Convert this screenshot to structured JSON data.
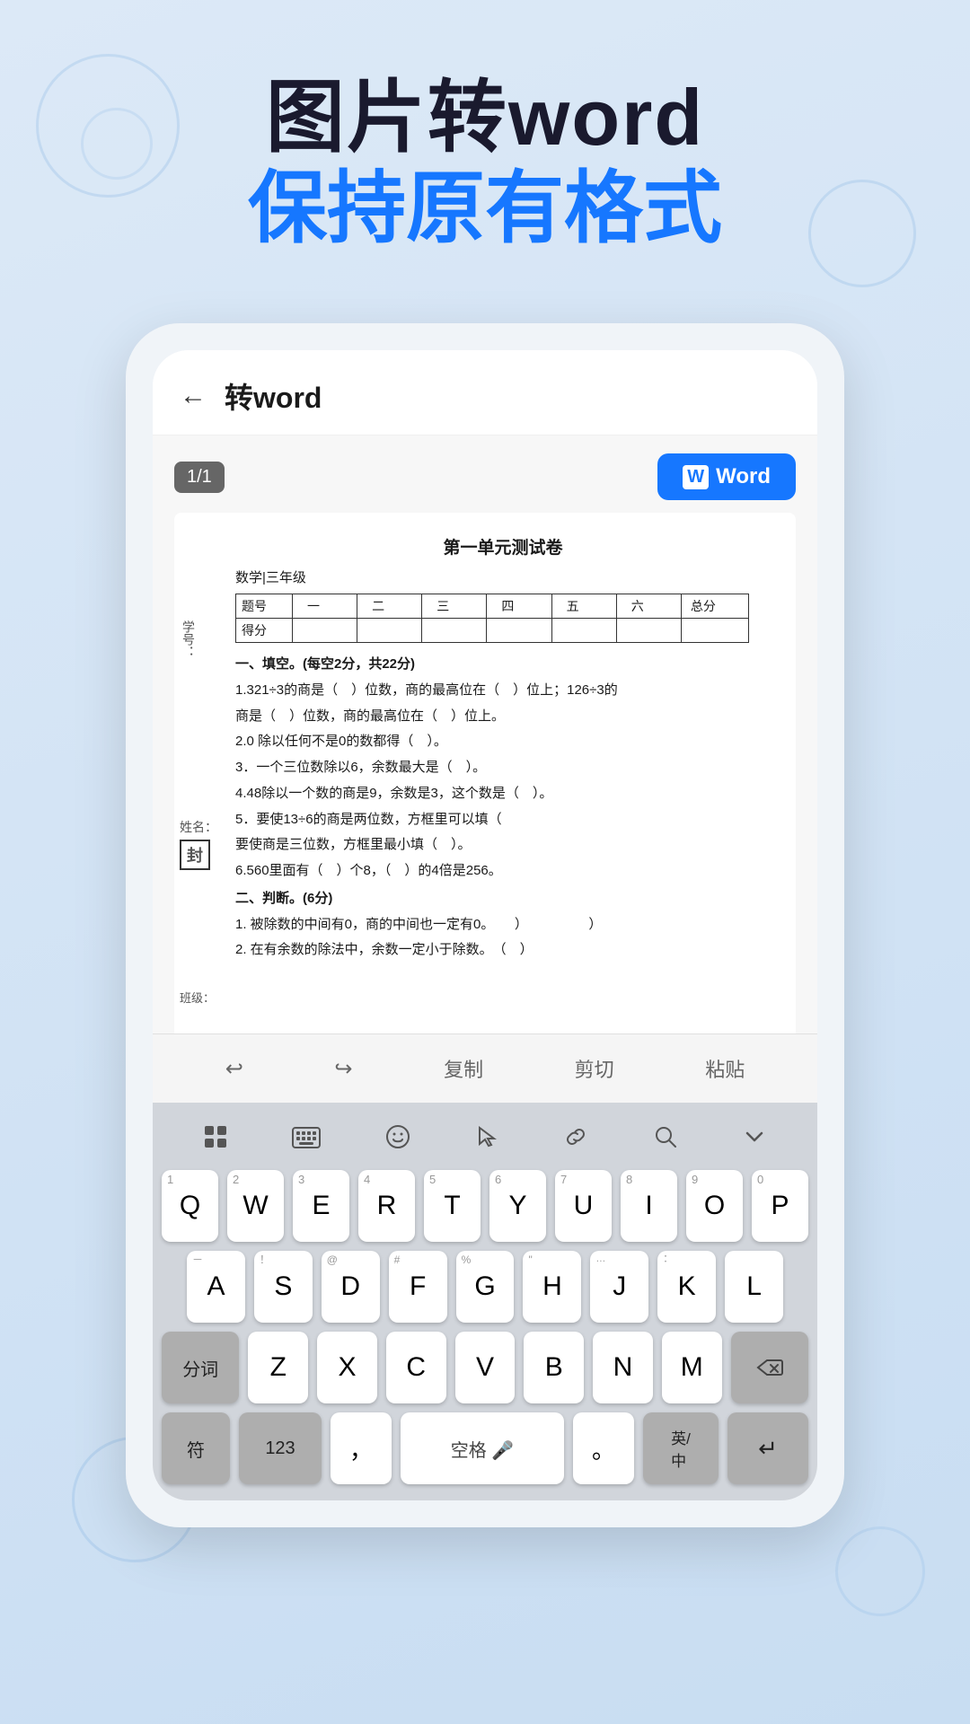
{
  "header": {
    "line1": "图片转word",
    "line2_prefix": "保持",
    "line2_blue": "原有格式",
    "line2_suffix": ""
  },
  "phone": {
    "topbar": {
      "title": "转word",
      "back_label": "←"
    },
    "page_badge": "1/1",
    "word_button": "Word",
    "document": {
      "title": "第一单元测试卷",
      "info_xue": "学号：",
      "info_subject": "数学|三年级",
      "table_headers": [
        "题号",
        "一",
        "二",
        "三",
        "四",
        "五",
        "六",
        "总分"
      ],
      "table_row": [
        "得分",
        "",
        "",
        "",
        "",
        "",
        "",
        ""
      ],
      "grade_label": "姓名：",
      "seal_label": "封",
      "class_label": "班级：",
      "section1_title": "一、填空。(每空2分，共22分)",
      "items": [
        "1.321÷3的商是（）位数，商的最高位在（）位上；126÷3的",
        "商是（）位数，商的最高位在（）位上。",
        "2.0 除以任何不是0的数都得（）。",
        "3．一个三位数除以6，余数最大是（）。",
        "4.48除以一个数的商是9，余数是3，这个数是（）。",
        "5．要使13÷6的商是两位数，方框里可以填（",
        "要使商是三位数，方框里最小填（）。",
        "6.560里面有（）个8，（）的4倍是256。"
      ],
      "section2_title": "二、判断。(6分)",
      "judge_items": [
        "1. 被除数的中间有0，商的中间也一定有0。　　）　　　　）",
        "2. 在有余数的除法中，余数一定小于除数。　（）"
      ]
    },
    "edit_toolbar": {
      "undo": "↩",
      "redo": "↪",
      "copy": "复制",
      "cut": "剪切",
      "paste": "粘贴"
    },
    "keyboard": {
      "top_icons": [
        "grid",
        "keyboard",
        "emoji",
        "cursor",
        "link",
        "search",
        "chevron"
      ],
      "row1": [
        {
          "num": "1",
          "char": "Q"
        },
        {
          "num": "2",
          "char": "W"
        },
        {
          "num": "3",
          "char": "E"
        },
        {
          "num": "4",
          "char": "R"
        },
        {
          "num": "5",
          "char": "T"
        },
        {
          "num": "6",
          "char": "Y"
        },
        {
          "num": "7",
          "char": "U"
        },
        {
          "num": "8",
          "char": "I"
        },
        {
          "num": "9",
          "char": "O"
        },
        {
          "num": "0",
          "char": "P"
        }
      ],
      "row2": [
        {
          "num": "－",
          "char": "A"
        },
        {
          "num": "！",
          "char": "S"
        },
        {
          "num": "@",
          "char": "D"
        },
        {
          "num": "#",
          "char": "F"
        },
        {
          "num": "%",
          "char": "G"
        },
        {
          "num": "\"",
          "char": "H"
        },
        {
          "num": "…",
          "char": "J"
        },
        {
          "num": "：",
          "char": "K"
        },
        {
          "num": "",
          "char": "L"
        }
      ],
      "row3_left": "分词",
      "row3": [
        {
          "num": "",
          "char": "Z"
        },
        {
          "num": "",
          "char": "X"
        },
        {
          "num": "",
          "char": "C"
        },
        {
          "num": "",
          "char": "V"
        },
        {
          "num": "",
          "char": "B"
        },
        {
          "num": "",
          "char": "N"
        },
        {
          "num": "",
          "char": "M"
        }
      ],
      "row3_right": "⌫",
      "bottom": {
        "func1": "符",
        "num": "123",
        "comma": "，",
        "space": "空格 🎤",
        "period": "。",
        "lang": "英/中",
        "enter": "↵"
      }
    }
  }
}
